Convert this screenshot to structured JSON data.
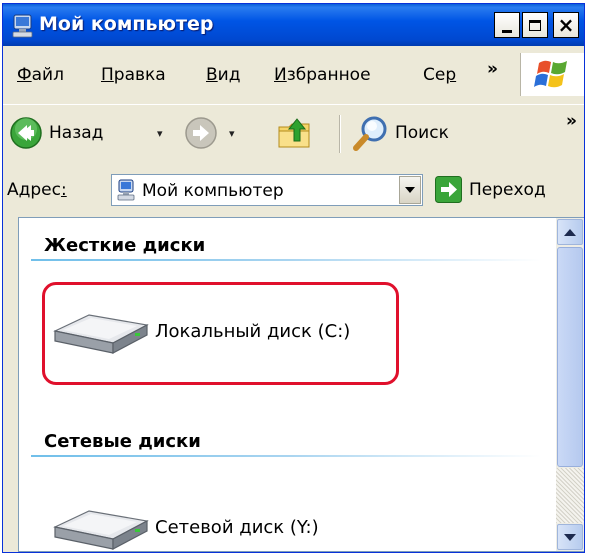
{
  "window": {
    "title": "Мой компьютер"
  },
  "caption_buttons": {
    "minimize": "minimize",
    "maximize": "maximize",
    "close": "×"
  },
  "menu": {
    "items": [
      {
        "accel": "Ф",
        "rest": "айл"
      },
      {
        "accel": "П",
        "rest": "равка"
      },
      {
        "accel": "В",
        "rest": "ид"
      },
      {
        "accel": "И",
        "rest": "збранное"
      },
      {
        "accel": "Се",
        "rest": "р"
      }
    ],
    "chevron": "»"
  },
  "toolbar": {
    "back_label": "Назад",
    "search_label": "Поиск",
    "chevron": "»",
    "dropdown_glyph": "▾"
  },
  "address": {
    "label_main": "Адрес",
    "label_accel": ":",
    "value": "Мой компьютер",
    "go_label": "Переход"
  },
  "content": {
    "groups": [
      {
        "header": "Жесткие диски",
        "items": [
          {
            "label": "Локальный диск (C:)",
            "icon": "hard-drive-icon"
          }
        ]
      },
      {
        "header": "Сетевые диски",
        "items": [
          {
            "label": "Сетевой диск (Y:)",
            "icon": "network-drive-icon"
          }
        ]
      }
    ]
  },
  "colors": {
    "titlebar": "#0055e5",
    "highlight": "#e0102c",
    "chrome": "#ece9d8"
  }
}
